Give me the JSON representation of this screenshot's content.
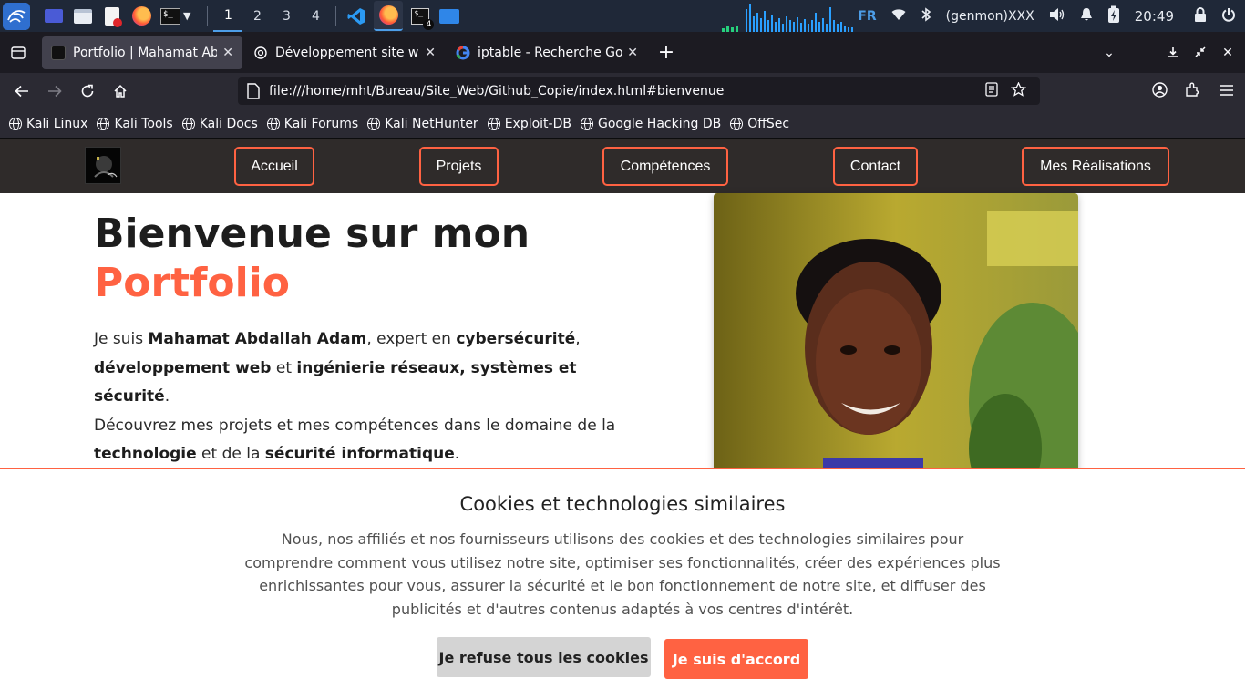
{
  "system_panel": {
    "workspaces": [
      "1",
      "2",
      "3",
      "4"
    ],
    "active_workspace": "1",
    "terminal_badge": "4",
    "keyboard_layout": "FR",
    "genmon": "(genmon)XXX",
    "clock": "20:49"
  },
  "browser": {
    "tabs": [
      {
        "title": "Portfolio | Mahamat Abdallah",
        "active": true
      },
      {
        "title": "Développement site web",
        "active": false
      },
      {
        "title": "iptable - Recherche Google",
        "active": false
      }
    ],
    "new_tab_label": "+",
    "url": "file:///home/mht/Bureau/Site_Web/Github_Copie/index.html#bienvenue",
    "bookmarks": [
      "Kali Linux",
      "Kali Tools",
      "Kali Docs",
      "Kali Forums",
      "Kali NetHunter",
      "Exploit-DB",
      "Google Hacking DB",
      "OffSec"
    ]
  },
  "site": {
    "nav": {
      "accueil": "Accueil",
      "projets": "Projets",
      "competences": "Compétences",
      "contact": "Contact",
      "realisations": "Mes Réalisations"
    },
    "hero": {
      "title_line1": "Bienvenue sur mon",
      "title_accent": "Portfolio",
      "p1_a": "Je suis ",
      "p1_name": "Mahamat Abdallah Adam",
      "p1_b": ", expert en ",
      "p1_cyber": "cybersécurité",
      "p1_c": ",",
      "p1_web": "développement web",
      "p1_d": " et ",
      "p1_ing": "ingénierie réseaux, systèmes et sécurité",
      "p1_e": ".",
      "p2_a": "Découvrez mes projets et mes compétences dans le domaine de la ",
      "p2_tech": "technologie",
      "p2_b": " et de la ",
      "p2_sec": "sécurité informatique",
      "p2_c": "."
    },
    "accent_color": "#ff6242"
  },
  "cookie_banner": {
    "title": "Cookies et technologies similaires",
    "text": "Nous, nos affiliés et nos fournisseurs utilisons des cookies et des technologies similaires pour comprendre comment vous utilisez notre site, optimiser ses fonctionnalités, créer des expériences plus enrichissantes pour vous, assurer la sécurité et le bon fonctionnement de notre site, et diffuser des publicités et d'autres contenus adaptés à vos centres d'intérêt.",
    "refuse_label": "Je refuse tous les cookies",
    "accept_label": "Je suis d'accord"
  }
}
